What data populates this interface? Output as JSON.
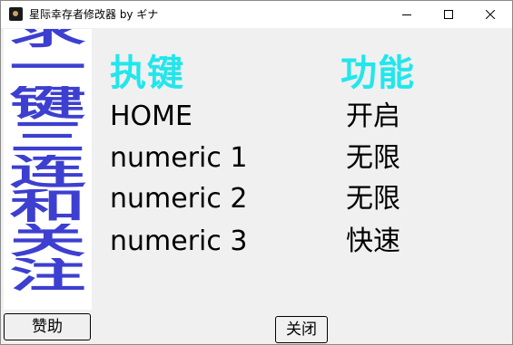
{
  "window": {
    "title": "星际幸存者修改器 by ギナ"
  },
  "title_buttons": {
    "minimize": "minimize-icon",
    "maximize": "maximize-icon",
    "close": "close-icon"
  },
  "banner": {
    "chars": [
      "求",
      "一",
      "键",
      "三",
      "连",
      "和",
      "关",
      "注"
    ]
  },
  "table": {
    "key_header": "执键",
    "func_header": "功能",
    "rows": [
      {
        "key": "HOME",
        "func": "开启"
      },
      {
        "key": "numeric 1",
        "func": "无限"
      },
      {
        "key": "numeric 2",
        "func": "无限"
      },
      {
        "key": "numeric 3",
        "func": "快速"
      }
    ]
  },
  "buttons": {
    "sponsor": "赞助",
    "close": "关闭"
  },
  "colors": {
    "banner": "#3d3fd0",
    "header": "#22e6ec"
  }
}
